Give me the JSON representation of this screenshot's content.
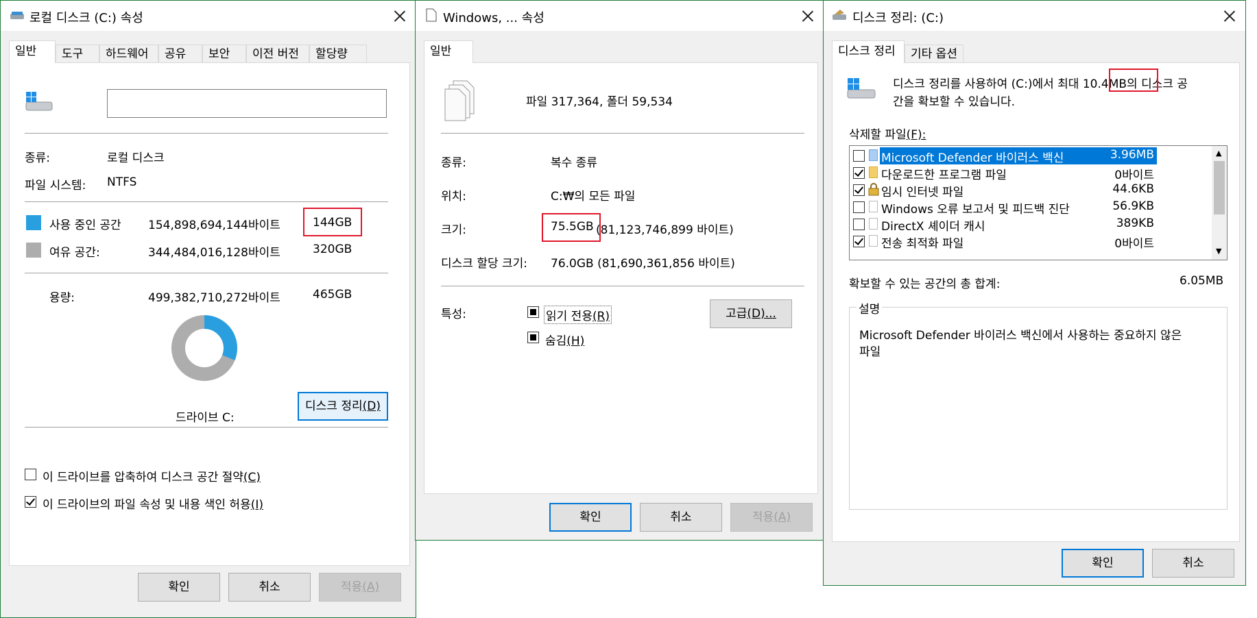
{
  "win1": {
    "title": "로컬 디스크 (C:) 속성",
    "tabs": [
      "일반",
      "도구",
      "하드웨어",
      "공유",
      "보안",
      "이전 버전",
      "할당량"
    ],
    "name_value": "",
    "type_label": "종류:",
    "type_value": "로컬 디스크",
    "fs_label": "파일 시스템:",
    "fs_value": "NTFS",
    "used_label": "사용 중인 공간",
    "used_bytes": "154,898,694,144바이트",
    "used_size": "144GB",
    "free_label": "여유 공간:",
    "free_bytes": "344,484,016,128바이트",
    "free_size": "320GB",
    "cap_label": "용량:",
    "cap_bytes": "499,382,710,272바이트",
    "cap_size": "465GB",
    "drive_label": "드라이브 C:",
    "cleanup_btn": "디스크 정리",
    "cleanup_key": "(D)",
    "compress_label": "이 드라이브를 압축하여 디스크 공간 절약",
    "compress_key": "(C)",
    "compress_checked": false,
    "index_label": "이 드라이브의 파일 속성 및 내용 색인 허용",
    "index_key": "(I)",
    "index_checked": true,
    "ok": "확인",
    "cancel": "취소",
    "apply": "적용",
    "apply_key": "(A)",
    "used_fraction": 0.31,
    "colors": {
      "used": "#2a9fe0",
      "free": "#adadad",
      "highlight": "#e0162b"
    }
  },
  "win2": {
    "title": "Windows, ... 속성",
    "tab": "일반",
    "files_summary": "파일 317,364, 폴더 59,534",
    "type_label": "종류:",
    "type_value": "복수 종류",
    "loc_label": "위치:",
    "loc_value": "C:₩의 모든 파일",
    "size_label": "크기:",
    "size_value": "75.5GB",
    "size_bytes": "(81,123,746,899 바이트)",
    "alloc_label": "디스크 할당 크기:",
    "alloc_value": "76.0GB (81,690,361,856 바이트)",
    "attr_label": "특성:",
    "readonly_label": "읽기 전용",
    "readonly_key": "(R)",
    "hidden_label": "숨김",
    "hidden_key": "(H)",
    "advanced_btn": "고급",
    "advanced_key": "(D)...",
    "ok": "확인",
    "cancel": "취소",
    "apply": "적용",
    "apply_key": "(A)"
  },
  "win3": {
    "title": "디스크 정리: (C:)",
    "tabs": [
      "디스크 정리",
      "기타 옵션"
    ],
    "desc_pre": "디스크 정리를 사용하여 (C:)에서 최대 ",
    "desc_size": "10.4MB",
    "desc_post": "의 디스크 공",
    "desc_line2": "간을 확보할 수 있습니다.",
    "files_label": "삭제할 파일",
    "files_key": "(F):",
    "items": [
      {
        "label": "Microsoft Defender 바이러스 백신",
        "size": "3.96MB",
        "checked": false,
        "selected": true
      },
      {
        "label": "다운로드한 프로그램 파일",
        "size": "0바이트",
        "checked": true,
        "selected": false
      },
      {
        "label": "임시 인터넷 파일",
        "size": "44.6KB",
        "checked": true,
        "selected": false
      },
      {
        "label": "Windows 오류 보고서 및 피드백 진단",
        "size": "56.9KB",
        "checked": false,
        "selected": false
      },
      {
        "label": "DirectX 셰이더 캐시",
        "size": "389KB",
        "checked": false,
        "selected": false
      },
      {
        "label": "전송 최적화 파일",
        "size": "0바이트",
        "checked": true,
        "selected": false
      }
    ],
    "total_label": "확보할 수 있는 공간의 총 합계:",
    "total_value": "6.05MB",
    "group_label": "설명",
    "description": "Microsoft Defender 바이러스 백신에서 사용하는 중요하지 않은",
    "description2": "파일",
    "ok": "확인",
    "cancel": "취소"
  }
}
